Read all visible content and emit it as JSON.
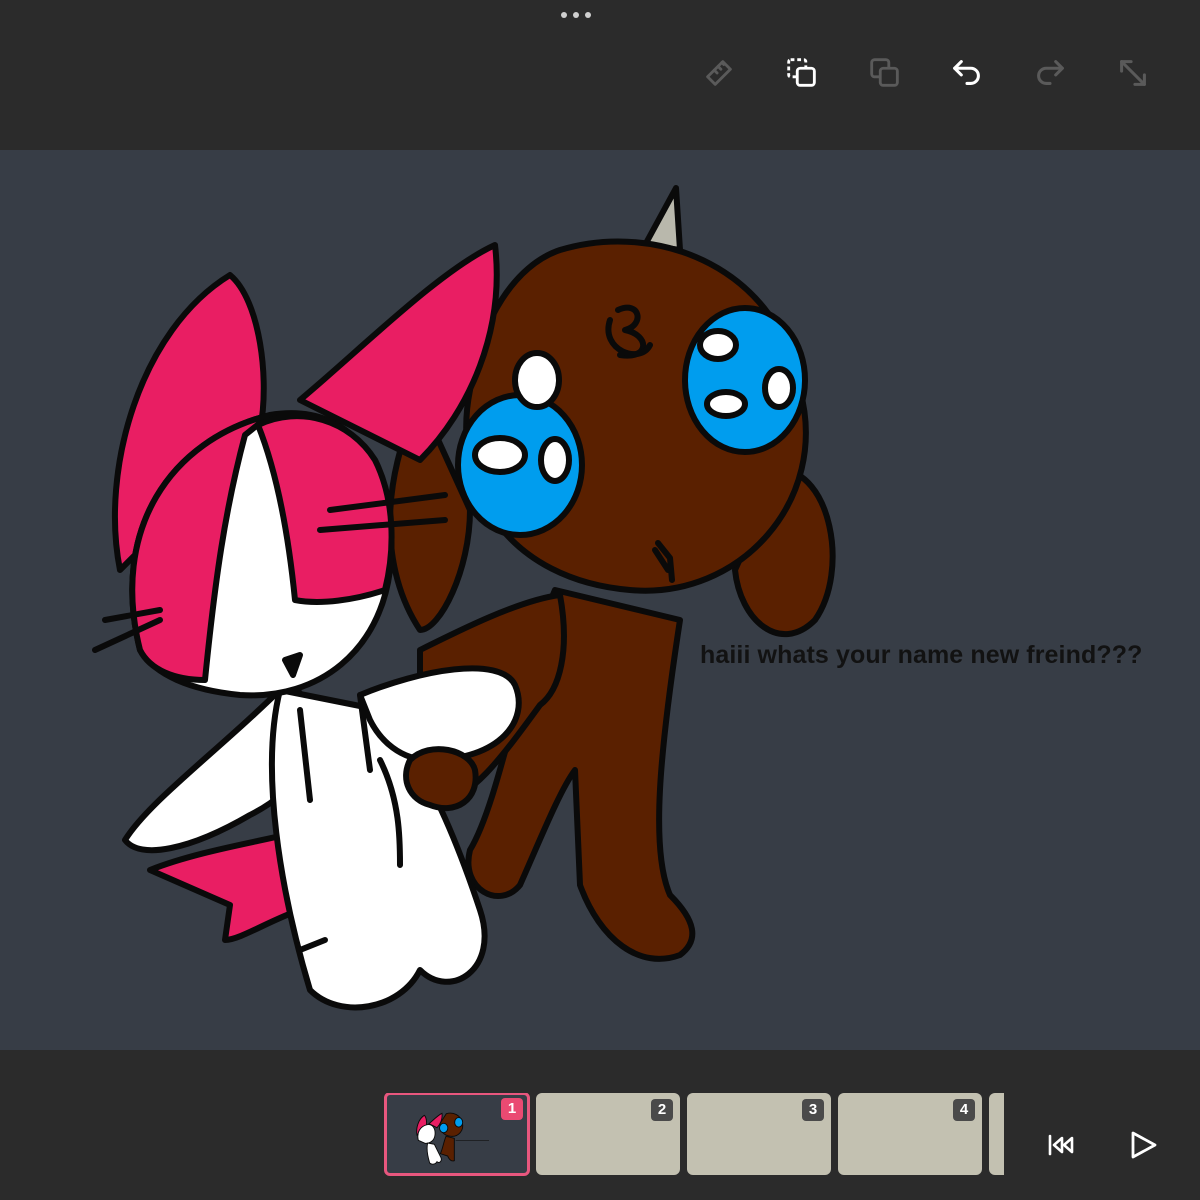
{
  "toolbar": {
    "tools": [
      {
        "icon": "ruler-icon",
        "enabled": false
      },
      {
        "icon": "copy-selection-icon",
        "enabled": true
      },
      {
        "icon": "duplicate-layer-icon",
        "enabled": false
      },
      {
        "icon": "undo-icon",
        "enabled": true
      },
      {
        "icon": "redo-icon",
        "enabled": false
      },
      {
        "icon": "fullscreen-icon",
        "enabled": false
      }
    ]
  },
  "canvas": {
    "caption": "haiii whats your name new freind???",
    "background": "#373d46"
  },
  "timeline": {
    "frames": [
      {
        "number": "1",
        "active": true
      },
      {
        "number": "2",
        "active": false
      },
      {
        "number": "3",
        "active": false
      },
      {
        "number": "4",
        "active": false
      }
    ],
    "active_color": "#ea4a72"
  },
  "playback": {
    "controls": [
      "rewind-to-start-icon",
      "play-icon"
    ]
  }
}
